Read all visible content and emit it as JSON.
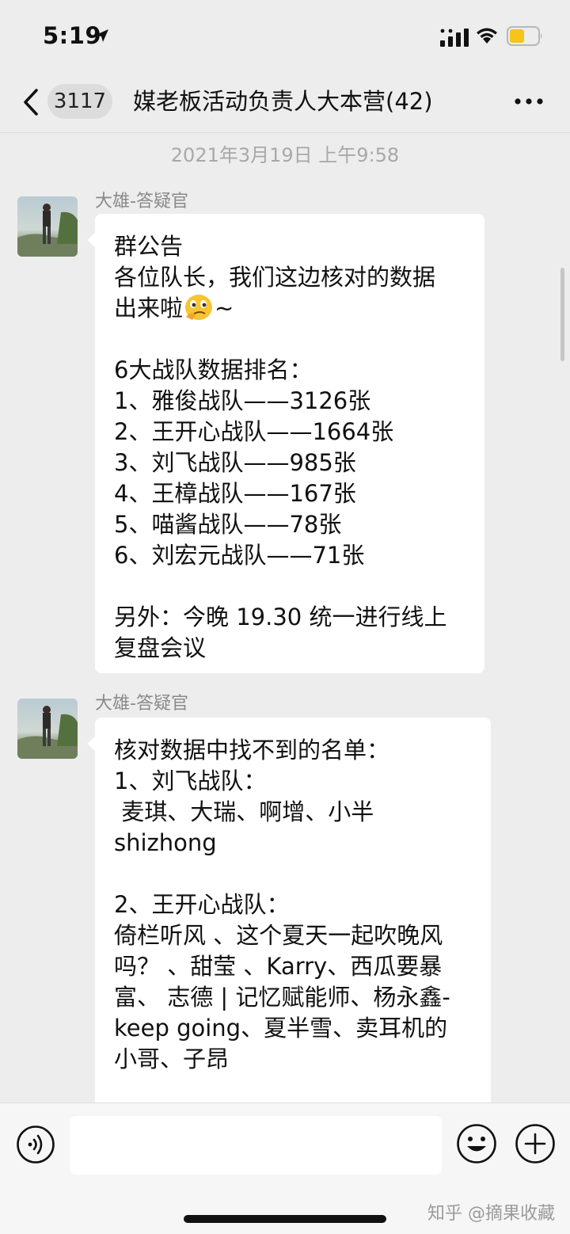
{
  "status_bar": {
    "time": "5:19"
  },
  "nav": {
    "unread_count": "3117",
    "title": "媒老板活动负责人大本营(42)"
  },
  "chat": {
    "date_divider": "2021年3月19日 上午9:58",
    "messages": [
      {
        "sender": "大雄-答疑官",
        "lines": [
          "群公告",
          "各位队长，我们这边核对的数据",
          "出来啦",
          "~",
          "",
          "6大战队数据排名：",
          "1、雅俊战队——3126张",
          "2、王开心战队——1664张",
          "3、刘飞战队——985张",
          "4、王樟战队——167张",
          "5、喵酱战队——78张",
          "6、刘宏元战队——71张",
          "",
          "另外：今晚 19.30 统一进行线上",
          "复盘会议"
        ]
      },
      {
        "sender": "大雄-答疑官",
        "lines": [
          "核对数据中找不到的名单：",
          "1、刘飞战队：",
          " 麦琪、大瑞、啊增、小半",
          "shizhong",
          "",
          "2、王开心战队：",
          "倚栏听风 、这个夏天一起吹晚风",
          "吗？ 、甜莹 、Karry、西瓜要暴",
          "富、 志德 | 记忆赋能师、杨永鑫-",
          "keep going、夏半雪、卖耳机的",
          "小哥、子昂"
        ]
      }
    ]
  },
  "input": {
    "placeholder": ""
  },
  "watermark": "知乎 @摘果收藏",
  "icons": {
    "back": "chevron-left-icon",
    "more": "more-dots-icon",
    "voice": "voice-icon",
    "emoji": "emoji-icon",
    "plus": "plus-icon",
    "signal": "signal-icon",
    "wifi": "wifi-icon",
    "battery": "battery-icon",
    "location": "location-arrow-icon"
  },
  "colors": {
    "background": "#ededed",
    "bubble": "#ffffff",
    "battery_fill": "#f5c518"
  }
}
